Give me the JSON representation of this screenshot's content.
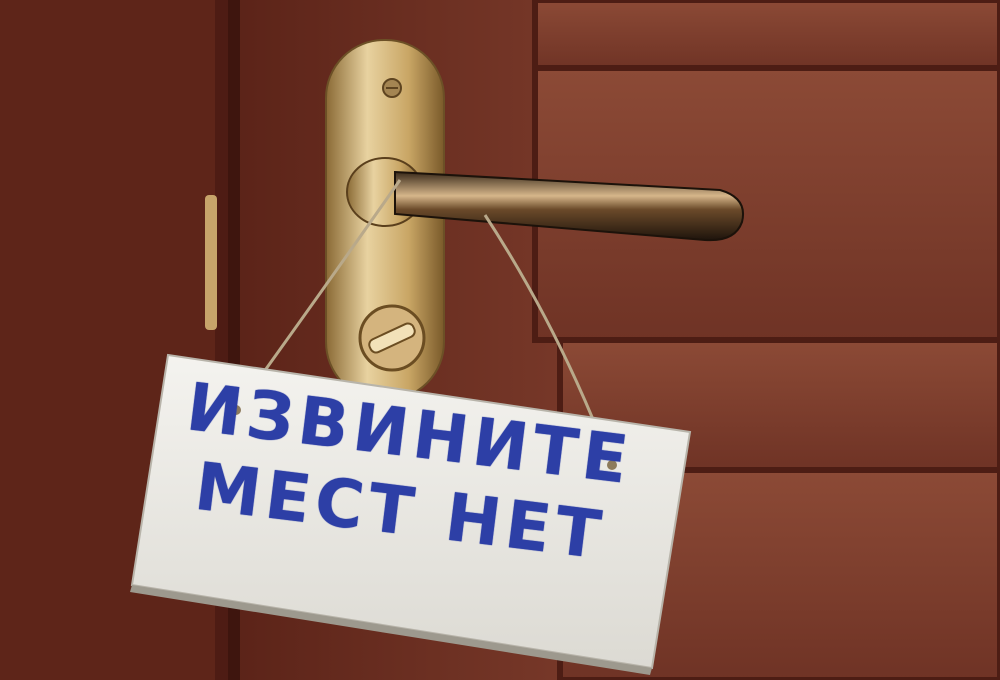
{
  "sign": {
    "line1": "ИЗВИНИТЕ",
    "line2": "МЕСТ НЕТ",
    "text_color": "#2d3fa6",
    "board_color": "#ecebe6"
  },
  "door": {
    "wood_color": "#7a3a2a",
    "handle_color": "#c9a25c"
  }
}
